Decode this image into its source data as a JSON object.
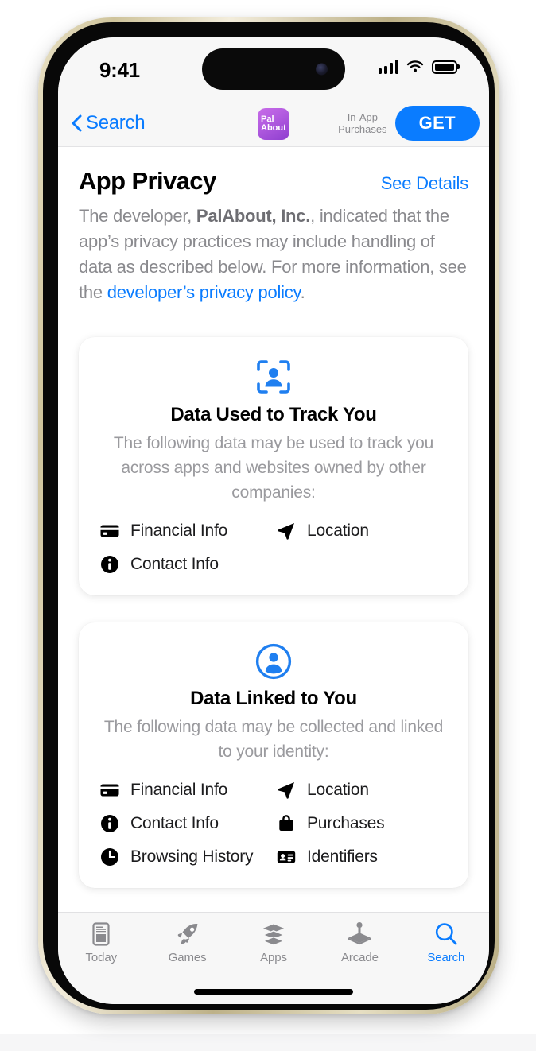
{
  "status_bar": {
    "time": "9:41",
    "icons": [
      "cellular-signal-icon",
      "wifi-icon",
      "battery-icon"
    ]
  },
  "nav_bar": {
    "back_label": "Search",
    "back_icon": "chevron-left-icon",
    "app_icon": {
      "name": "palabout-app-icon",
      "line1": "Pal",
      "line2": "About"
    },
    "in_app_purchases_label": "In-App\nPurchases",
    "get_label": "GET"
  },
  "privacy": {
    "title": "App Privacy",
    "see_details_label": "See Details",
    "description_part1": "The developer, ",
    "description_developer": "PalAbout, Inc.",
    "description_part2": ", indicated that the app’s privacy practices may include handling of data as described below. For more information, see the ",
    "description_link": "developer’s privacy policy",
    "description_part3": "."
  },
  "cards": [
    {
      "icon": "person-in-viewfinder-icon",
      "title": "Data Used to Track You",
      "subtitle": "The following data may be used to track you across apps and websites owned by other companies:",
      "items": [
        {
          "icon": "credit-card-icon",
          "label": "Financial Info"
        },
        {
          "icon": "location-arrow-icon",
          "label": "Location"
        },
        {
          "icon": "info-circle-icon",
          "label": "Contact Info"
        }
      ]
    },
    {
      "icon": "person-circle-icon",
      "title": "Data Linked to You",
      "subtitle": "The following data may be collected and linked to your identity:",
      "items": [
        {
          "icon": "credit-card-icon",
          "label": "Financial Info"
        },
        {
          "icon": "location-arrow-icon",
          "label": "Location"
        },
        {
          "icon": "info-circle-icon",
          "label": "Contact Info"
        },
        {
          "icon": "shopping-bag-icon",
          "label": "Purchases"
        },
        {
          "icon": "clock-icon",
          "label": "Browsing History"
        },
        {
          "icon": "id-card-icon",
          "label": "Identifiers"
        }
      ]
    }
  ],
  "tab_bar": {
    "tabs": [
      {
        "label": "Today",
        "icon": "today-doc-icon",
        "active": false
      },
      {
        "label": "Games",
        "icon": "rocket-icon",
        "active": false
      },
      {
        "label": "Apps",
        "icon": "stack-icon",
        "active": false
      },
      {
        "label": "Arcade",
        "icon": "joystick-icon",
        "active": false
      },
      {
        "label": "Search",
        "icon": "search-icon",
        "active": true
      }
    ]
  },
  "colors": {
    "accent_blue": "#0a7cff",
    "muted_gray": "#8a8a8e",
    "screen_bg": "#ffffff",
    "chrome_bg": "#f7f7f7",
    "app_icon_purple": "#b35ce0"
  }
}
